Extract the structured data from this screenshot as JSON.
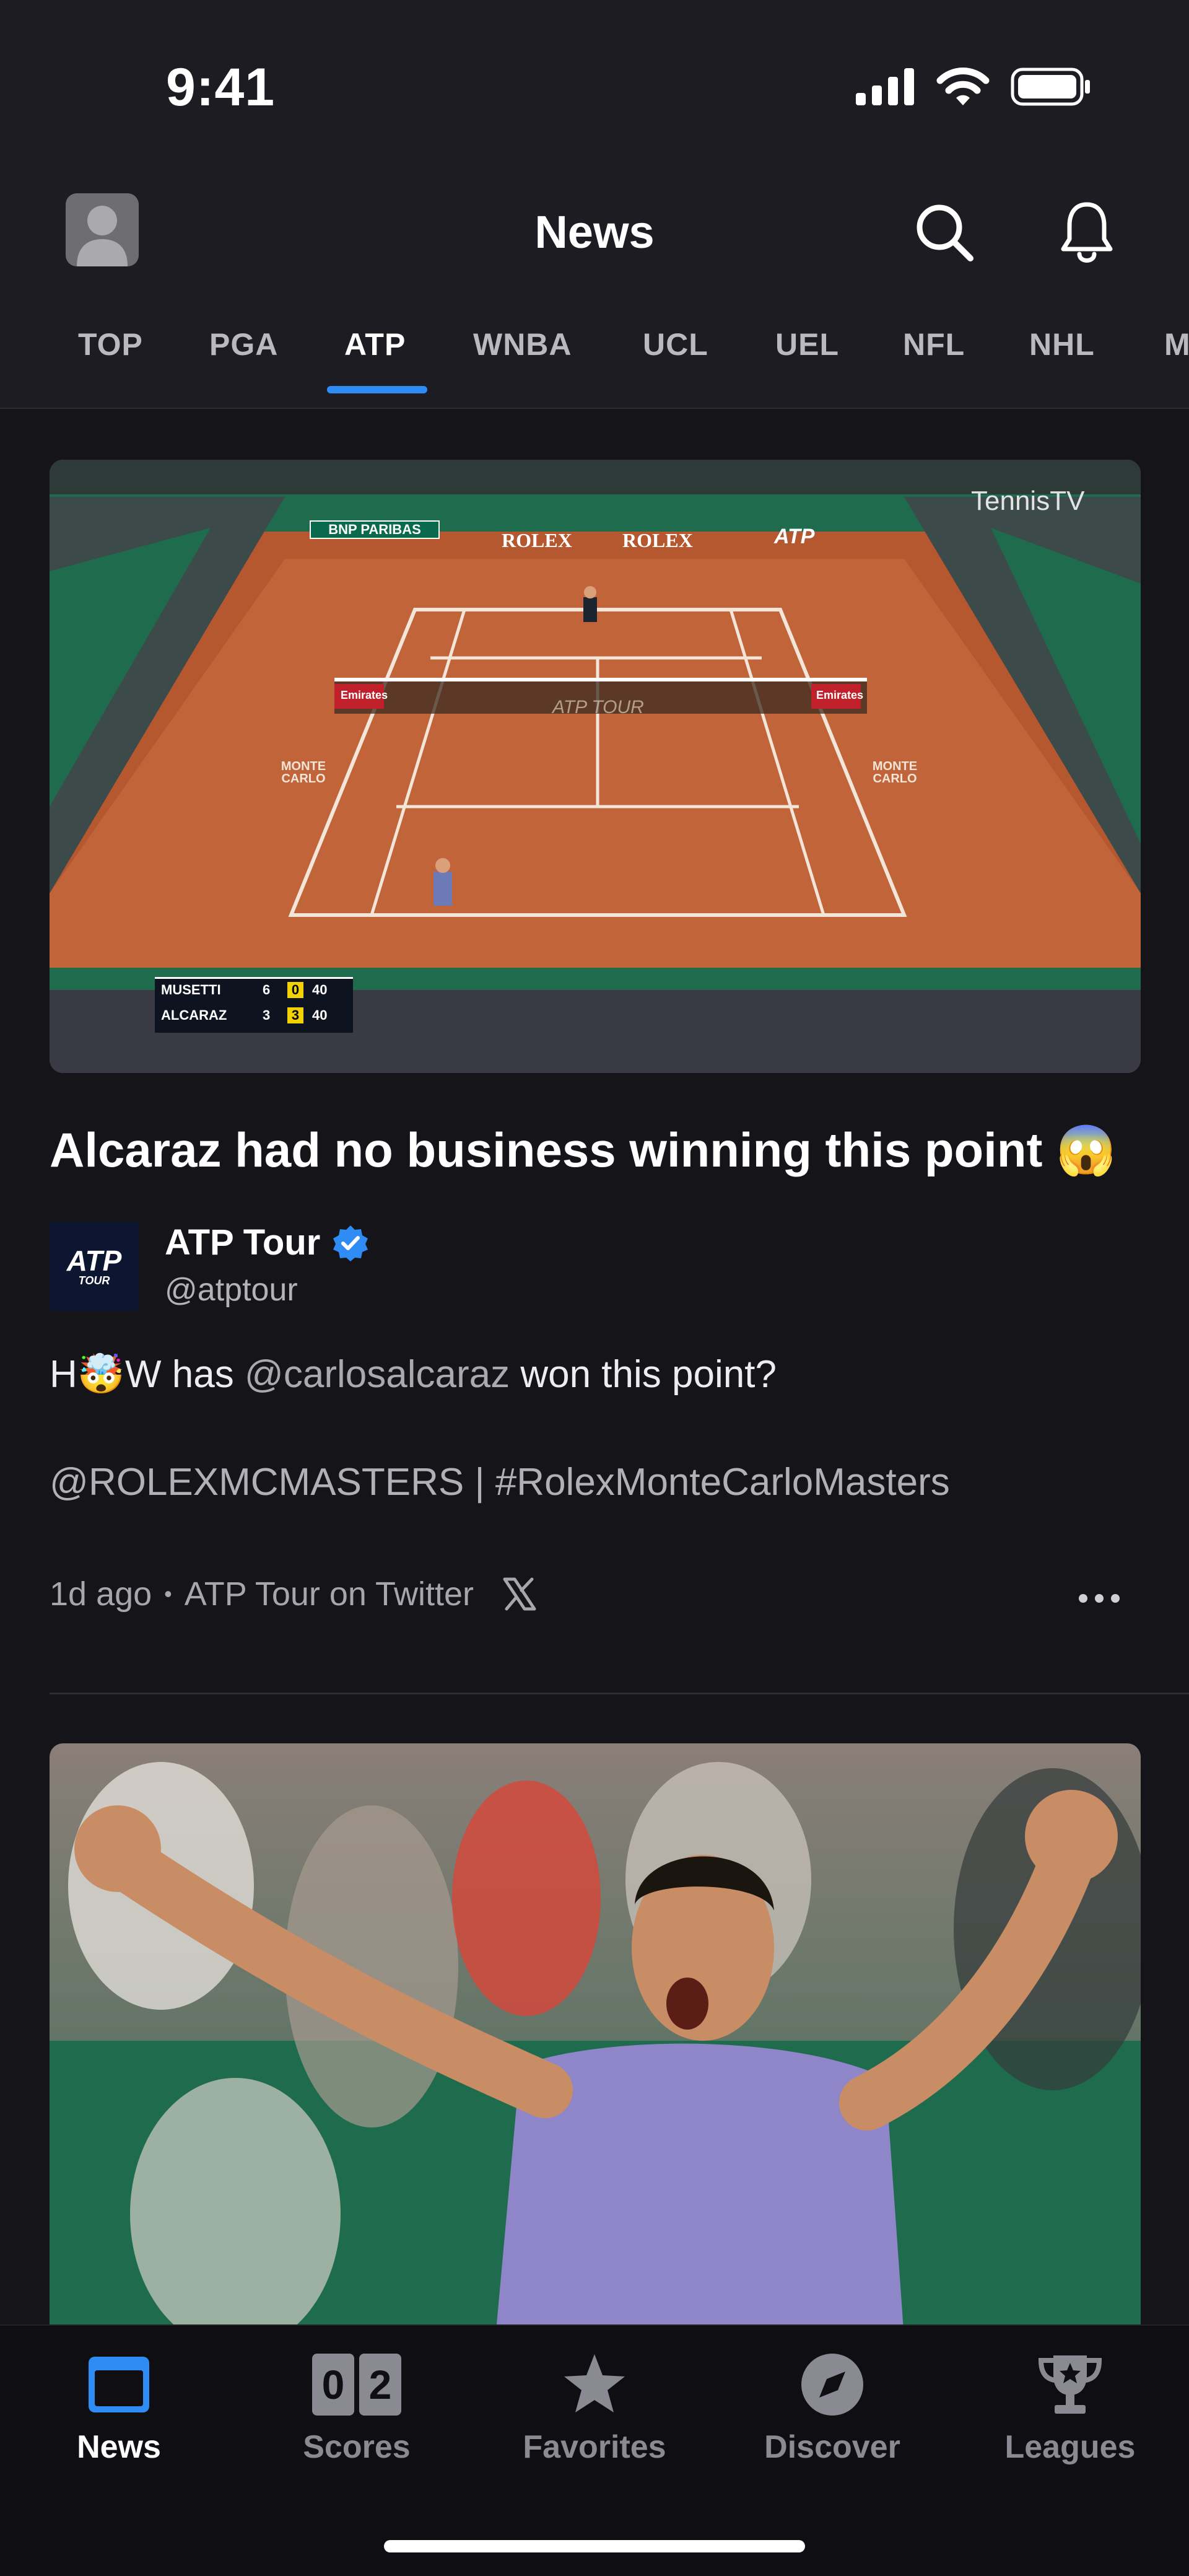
{
  "status_bar": {
    "time": "9:41"
  },
  "header": {
    "title": "News",
    "tabs": [
      "TOP",
      "PGA",
      "ATP",
      "WNBA",
      "UCL",
      "UEL",
      "NFL",
      "NHL",
      "M"
    ],
    "active_tab": "ATP",
    "accent_color": "#2f8cf5"
  },
  "feed": {
    "post": {
      "video_scoreboard": {
        "player1": "MUSETTI",
        "p1_sets": "6",
        "p1_games": "0",
        "p1_points": "40",
        "player2": "ALCARAZ",
        "p2_sets": "3",
        "p2_games": "3",
        "p2_points": "40"
      },
      "court_signage": {
        "sponsor1": "BNP PARIBAS",
        "rolex1": "ROLEX",
        "rolex2": "ROLEX",
        "atp": "ATP",
        "emirates_left": "Emirates",
        "emirates_right": "Emirates",
        "net_text": "ATP TOUR",
        "tennis_tv": "TennisTV",
        "monte_carlo_left": "MONTE CARLO",
        "monte_carlo_right": "MONTE CARLO"
      },
      "headline": "Alcaraz had no business winning this point 😱",
      "source_logo_text": "ATP",
      "source_logo_sub": "TOUR",
      "source_name": "ATP Tour",
      "source_handle": "@atptour",
      "tweet_prefix": "H",
      "tweet_emoji": "🤯",
      "tweet_mid": "W has ",
      "tweet_mention": "@carlosalcaraz",
      "tweet_suffix": " won this point?",
      "tweet_line2": "@ROLEXMCMASTERS | #RolexMonteCarloMasters",
      "time_ago": "1d ago",
      "separator": "•",
      "platform": "ATP Tour on Twitter"
    }
  },
  "tab_bar": {
    "items": [
      {
        "label": "News",
        "icon": "news-icon"
      },
      {
        "label": "Scores",
        "icon": "scores-icon",
        "digit1": "0",
        "digit2": "2"
      },
      {
        "label": "Favorites",
        "icon": "star-icon"
      },
      {
        "label": "Discover",
        "icon": "compass-icon"
      },
      {
        "label": "Leagues",
        "icon": "trophy-icon"
      }
    ],
    "active": "News"
  }
}
